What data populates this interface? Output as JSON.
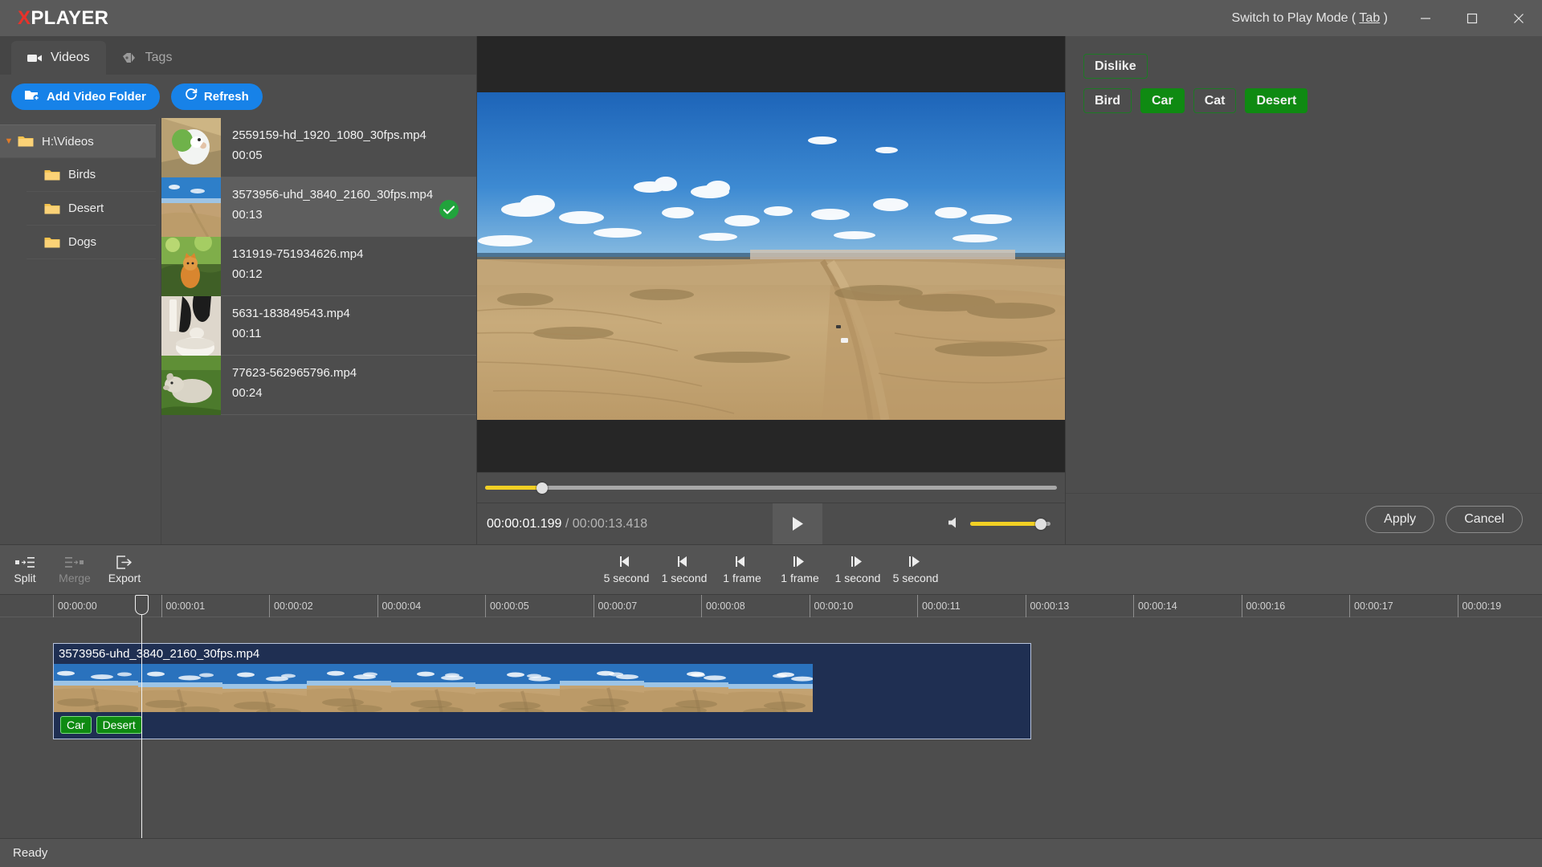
{
  "window": {
    "title": "XPLAYER",
    "title_x": "X",
    "title_rest": "PLAYER",
    "switch_mode_prefix": "Switch to Play Mode ( ",
    "switch_mode_key": "Tab",
    "switch_mode_suffix": " )",
    "minimize_label": "Minimize",
    "maximize_label": "Maximize",
    "close_label": "Close"
  },
  "left_panel": {
    "tabs": [
      {
        "label": "Videos",
        "icon": "video-camera-icon",
        "active": true
      },
      {
        "label": "Tags",
        "icon": "tag-icon",
        "active": false
      }
    ],
    "buttons": {
      "add_folder": "Add Video Folder",
      "refresh": "Refresh"
    },
    "tree": [
      {
        "label": "H:\\Videos",
        "level": 0,
        "expanded": true,
        "selected": true
      },
      {
        "label": "Birds",
        "level": 1,
        "expanded": false,
        "selected": false
      },
      {
        "label": "Desert",
        "level": 1,
        "expanded": false,
        "selected": false
      },
      {
        "label": "Dogs",
        "level": 1,
        "expanded": false,
        "selected": false
      }
    ],
    "videos": [
      {
        "name": "2559159-hd_1920_1080_30fps.mp4",
        "duration": "00:05",
        "thumb": "bird",
        "selected": false,
        "checked": false
      },
      {
        "name": "3573956-uhd_3840_2160_30fps.mp4",
        "duration": "00:13",
        "thumb": "desert",
        "selected": true,
        "checked": true
      },
      {
        "name": "131919-751934626.mp4",
        "duration": "00:12",
        "thumb": "cat",
        "selected": false,
        "checked": false
      },
      {
        "name": "5631-183849543.mp4",
        "duration": "00:11",
        "thumb": "dogcat",
        "selected": false,
        "checked": false
      },
      {
        "name": "77623-562965796.mp4",
        "duration": "00:24",
        "thumb": "dog",
        "selected": false,
        "checked": false
      }
    ]
  },
  "player": {
    "current_time": "00:00:01.199",
    "separator": "/",
    "total_time": "00:00:13.418",
    "seek_percent": 10,
    "volume_percent": 88,
    "play_state": "paused",
    "play_label": "Play"
  },
  "tag_panel": {
    "groups": [
      {
        "tags": [
          {
            "label": "Dislike",
            "selected": false
          }
        ]
      },
      {
        "tags": [
          {
            "label": "Bird",
            "selected": false
          },
          {
            "label": "Car",
            "selected": true
          },
          {
            "label": "Cat",
            "selected": false
          },
          {
            "label": "Desert",
            "selected": true
          }
        ]
      }
    ],
    "apply_label": "Apply",
    "cancel_label": "Cancel"
  },
  "edit_toolbar": {
    "tools": [
      {
        "label": "Split",
        "icon": "split-icon",
        "disabled": false
      },
      {
        "label": "Merge",
        "icon": "merge-icon",
        "disabled": true
      },
      {
        "label": "Export",
        "icon": "export-icon",
        "disabled": false
      }
    ],
    "nav_buttons": [
      {
        "label": "5 second",
        "dir": "back",
        "icon": "step-back-icon"
      },
      {
        "label": "1 second",
        "dir": "back",
        "icon": "step-back-icon"
      },
      {
        "label": "1 frame",
        "dir": "back",
        "icon": "step-back-icon"
      },
      {
        "label": "1 frame",
        "dir": "fwd",
        "icon": "step-forward-icon"
      },
      {
        "label": "1 second",
        "dir": "fwd",
        "icon": "step-forward-icon"
      },
      {
        "label": "5 second",
        "dir": "fwd",
        "icon": "step-forward-icon"
      }
    ]
  },
  "timeline": {
    "ticks": [
      "00:00:00",
      "00:00:01",
      "00:00:02",
      "00:00:04",
      "00:00:05",
      "00:00:07",
      "00:00:08",
      "00:00:10",
      "00:00:11",
      "00:00:13",
      "00:00:14",
      "00:00:16",
      "00:00:17",
      "00:00:19"
    ],
    "playhead_time": "00:00:01.199",
    "clip": {
      "title": "3573956-uhd_3840_2160_30fps.mp4",
      "tags": [
        "Car",
        "Desert"
      ],
      "thumb_count": 9
    }
  },
  "status": {
    "text": "Ready"
  }
}
